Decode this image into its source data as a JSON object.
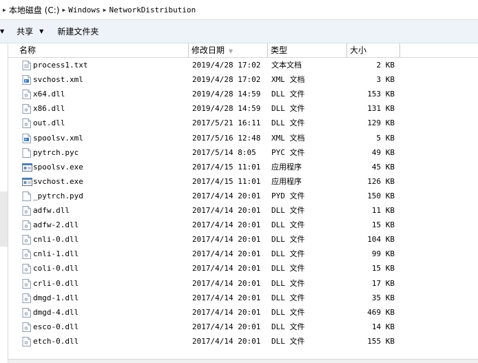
{
  "address": {
    "parts": [
      "本地磁盘 (C:)",
      "Windows",
      "NetworkDistribution"
    ]
  },
  "toolbar": {
    "share_label": "共享",
    "new_folder_label": "新建文件夹"
  },
  "columns": [
    "名称",
    "修改日期",
    "类型",
    "大小"
  ],
  "files": [
    {
      "name": "process1.txt",
      "date": "2019/4/28 17:02",
      "type": "文本文档",
      "size": "2 KB",
      "icon": "text-file-icon"
    },
    {
      "name": "svchost.xml",
      "date": "2019/4/28 17:02",
      "type": "XML 文档",
      "size": "3 KB",
      "icon": "xml-file-icon"
    },
    {
      "name": "x64.dll",
      "date": "2019/4/28 14:59",
      "type": "DLL 文件",
      "size": "153 KB",
      "icon": "dll-file-icon"
    },
    {
      "name": "x86.dll",
      "date": "2019/4/28 14:59",
      "type": "DLL 文件",
      "size": "131 KB",
      "icon": "dll-file-icon"
    },
    {
      "name": "out.dll",
      "date": "2017/5/21 16:11",
      "type": "DLL 文件",
      "size": "129 KB",
      "icon": "dll-file-icon"
    },
    {
      "name": "spoolsv.xml",
      "date": "2017/5/16 12:48",
      "type": "XML 文档",
      "size": "5 KB",
      "icon": "xml-file-icon"
    },
    {
      "name": "pytrch.pyc",
      "date": "2017/5/14 8:05",
      "type": "PYC 文件",
      "size": "49 KB",
      "icon": "generic-file-icon"
    },
    {
      "name": "spoolsv.exe",
      "date": "2017/4/15 11:01",
      "type": "应用程序",
      "size": "45 KB",
      "icon": "exe-file-icon"
    },
    {
      "name": "svchost.exe",
      "date": "2017/4/15 11:01",
      "type": "应用程序",
      "size": "126 KB",
      "icon": "exe-file-icon"
    },
    {
      "name": "_pytrch.pyd",
      "date": "2017/4/14 20:01",
      "type": "PYD 文件",
      "size": "150 KB",
      "icon": "generic-file-icon"
    },
    {
      "name": "adfw.dll",
      "date": "2017/4/14 20:01",
      "type": "DLL 文件",
      "size": "11 KB",
      "icon": "dll-file-icon"
    },
    {
      "name": "adfw-2.dll",
      "date": "2017/4/14 20:01",
      "type": "DLL 文件",
      "size": "15 KB",
      "icon": "dll-file-icon"
    },
    {
      "name": "cnli-0.dll",
      "date": "2017/4/14 20:01",
      "type": "DLL 文件",
      "size": "104 KB",
      "icon": "dll-file-icon"
    },
    {
      "name": "cnli-1.dll",
      "date": "2017/4/14 20:01",
      "type": "DLL 文件",
      "size": "99 KB",
      "icon": "dll-file-icon"
    },
    {
      "name": "coli-0.dll",
      "date": "2017/4/14 20:01",
      "type": "DLL 文件",
      "size": "15 KB",
      "icon": "dll-file-icon"
    },
    {
      "name": "crli-0.dll",
      "date": "2017/4/14 20:01",
      "type": "DLL 文件",
      "size": "17 KB",
      "icon": "dll-file-icon"
    },
    {
      "name": "dmgd-1.dll",
      "date": "2017/4/14 20:01",
      "type": "DLL 文件",
      "size": "35 KB",
      "icon": "dll-file-icon"
    },
    {
      "name": "dmgd-4.dll",
      "date": "2017/4/14 20:01",
      "type": "DLL 文件",
      "size": "469 KB",
      "icon": "dll-file-icon"
    },
    {
      "name": "esco-0.dll",
      "date": "2017/4/14 20:01",
      "type": "DLL 文件",
      "size": "14 KB",
      "icon": "dll-file-icon"
    },
    {
      "name": "etch-0.dll",
      "date": "2017/4/14 20:01",
      "type": "DLL 文件",
      "size": "155 KB",
      "icon": "dll-file-icon"
    }
  ]
}
